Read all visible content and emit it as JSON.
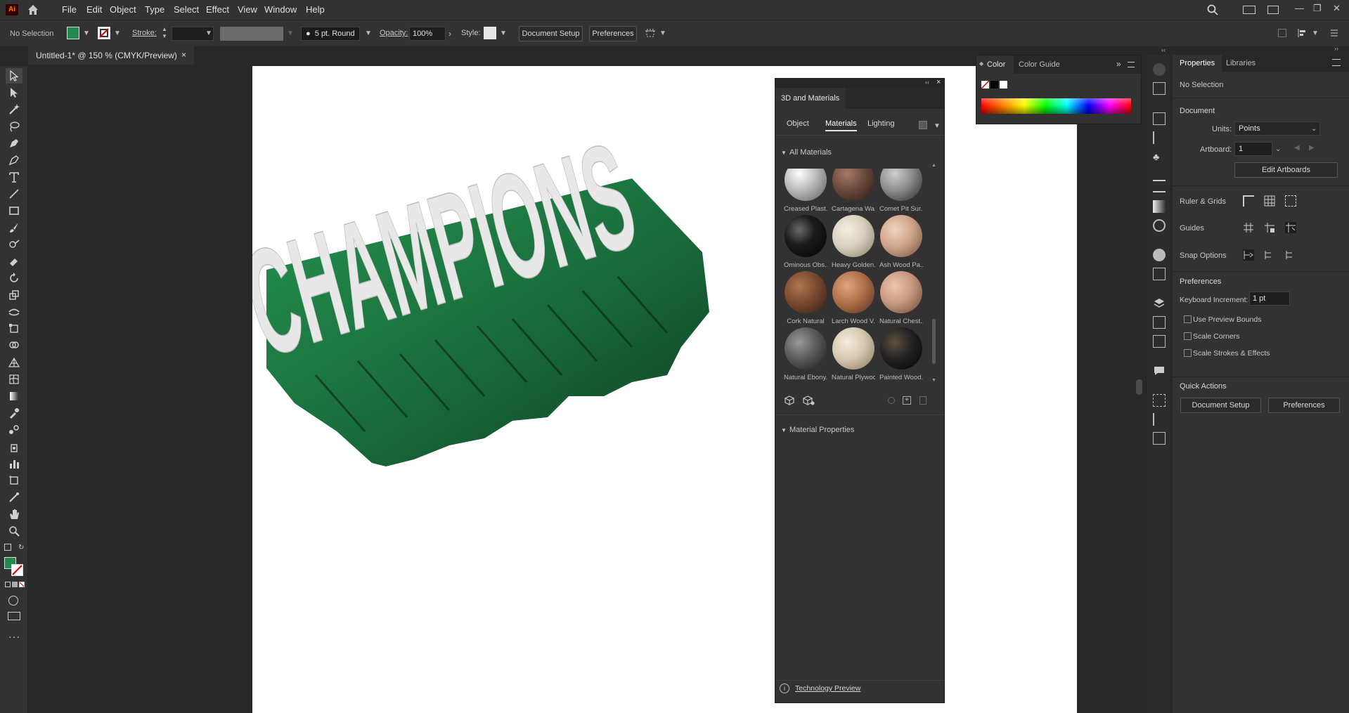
{
  "app": {
    "logo": "Ai",
    "home_icon": "home-icon"
  },
  "menu": [
    "File",
    "Edit",
    "Object",
    "Type",
    "Select",
    "Effect",
    "View",
    "Window",
    "Help"
  ],
  "control_bar": {
    "selection_status": "No Selection",
    "fill_color": "#1f8a4c",
    "stroke_label": "Stroke:",
    "brush_label": "5 pt. Round",
    "opacity_label": "Opacity:",
    "opacity_value": "100%",
    "style_label": "Style:",
    "document_setup": "Document Setup",
    "preferences": "Preferences"
  },
  "document_tab": {
    "title": "Untitled-1* @ 150 % (CMYK/Preview)",
    "close": "×"
  },
  "artwork": {
    "text": "CHAMPIONS",
    "face_color": "#e6e6e6",
    "extrude_color": "#1c7a42"
  },
  "panel_3d": {
    "title": "3D and Materials",
    "tabs": [
      "Object",
      "Materials",
      "Lighting"
    ],
    "active_tab": "Materials",
    "all_materials_header": "All Materials",
    "materials": [
      {
        "label": "Creased Plast...",
        "color": "#bcbcbc"
      },
      {
        "label": "Cartagena Wa...",
        "color": "#6a4a3c"
      },
      {
        "label": "Comet Pit Sur...",
        "color": "#8c8c8c"
      },
      {
        "label": "Ominous Obs...",
        "color": "#1a1a1a"
      },
      {
        "label": "Heavy Golden...",
        "color": "#d8cfbe"
      },
      {
        "label": "Ash Wood Pa...",
        "color": "#cfa48a"
      },
      {
        "label": "Cork Natural",
        "color": "#7a4a30"
      },
      {
        "label": "Larch Wood V...",
        "color": "#b0704a"
      },
      {
        "label": "Natural Chest...",
        "color": "#c89880"
      },
      {
        "label": "Natural Ebony...",
        "color": "#5a5a5a"
      },
      {
        "label": "Natural Plywood",
        "color": "#d6c8b0"
      },
      {
        "label": "Painted Wood...",
        "color": "#222222"
      }
    ],
    "material_properties_header": "Material Properties",
    "footer": "Technology Preview"
  },
  "color_panel": {
    "tabs": [
      "Color",
      "Color Guide"
    ],
    "active_tab": "Color"
  },
  "properties": {
    "tabs": [
      "Properties",
      "Libraries"
    ],
    "active_tab": "Properties",
    "selection": "No Selection",
    "document_header": "Document",
    "units_label": "Units:",
    "units_value": "Points",
    "artboard_label": "Artboard:",
    "artboard_value": "1",
    "edit_artboards": "Edit Artboards",
    "ruler_grids": "Ruler & Grids",
    "guides": "Guides",
    "snap_options": "Snap Options",
    "preferences_header": "Preferences",
    "keyboard_increment_label": "Keyboard Increment:",
    "keyboard_increment_value": "1 pt",
    "checkboxes": [
      "Use Preview Bounds",
      "Scale Corners",
      "Scale Strokes & Effects"
    ],
    "quick_actions": "Quick Actions",
    "document_setup": "Document Setup",
    "preferences": "Preferences"
  }
}
